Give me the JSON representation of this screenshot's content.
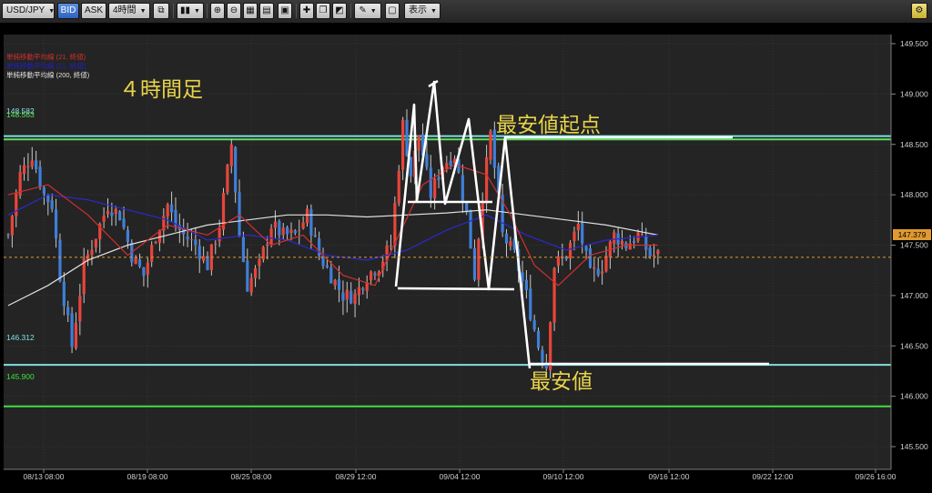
{
  "toolbar": {
    "symbol": "USD/JPY",
    "bid": "BID",
    "ask": "ASK",
    "timeframe": "4時間",
    "display": "表示",
    "icons": [
      "crosshair-icon",
      "bar-style-icon",
      "zoom-in-icon",
      "zoom-out-icon",
      "grid-icon",
      "calendar-icon",
      "add-indicator-icon",
      "copy-chart-icon",
      "drawing-tools-icon",
      "pen-icon",
      "screenshot-icon",
      "settings-icon"
    ]
  },
  "chart_data": {
    "type": "candlestick",
    "symbol": "USD/JPY",
    "timeframe": "4時間足",
    "legend": [
      {
        "label": "単純移動平均線 (21, 終値)",
        "color": "#d03030"
      },
      {
        "label": "単純移動平均線 (21, 終値)",
        "color": "#2020c0"
      },
      {
        "label": "単純移動平均線 (200, 終値)",
        "color": "#e0e0e0"
      }
    ],
    "ylim": [
      145.3,
      149.7
    ],
    "y_ticks": [
      "149.500",
      "149.000",
      "148.500",
      "148.000",
      "147.500",
      "147.000",
      "146.500",
      "146.000",
      "145.500"
    ],
    "x_ticks": [
      "08/13 08:00",
      "08/19 08:00",
      "08/25 08:00",
      "08/29 12:00",
      "09/04 12:00",
      "09/10 12:00",
      "09/16 12:00",
      "09/22 12:00",
      "09/26 16:00"
    ],
    "current_price": "147.379",
    "horizontal_lines": [
      {
        "label": "148.582",
        "value": 148.582,
        "color": "#7fe0e0"
      },
      {
        "label": "148.563",
        "value": 148.55,
        "color": "#60e060"
      },
      {
        "label": "146.312",
        "value": 146.312,
        "color": "#7fe0e0"
      },
      {
        "label": "145.900",
        "value": 145.9,
        "color": "#40e040"
      }
    ],
    "annotations": [
      {
        "text": "４時間足",
        "color": "#e8d44a"
      },
      {
        "text": "最安値起点",
        "color": "#e8d44a"
      },
      {
        "text": "最安値",
        "color": "#e8d44a"
      }
    ],
    "close_path": [
      [
        0,
        147.6
      ],
      [
        3,
        148.2
      ],
      [
        6,
        148.4
      ],
      [
        9,
        148.0
      ],
      [
        11,
        147.9
      ],
      [
        13,
        147.2
      ],
      [
        16,
        146.5
      ],
      [
        19,
        147.3
      ],
      [
        22,
        147.6
      ],
      [
        25,
        147.9
      ],
      [
        28,
        147.8
      ],
      [
        31,
        147.4
      ],
      [
        34,
        147.2
      ],
      [
        37,
        147.6
      ],
      [
        40,
        147.9
      ],
      [
        42,
        147.7
      ],
      [
        44,
        147.6
      ],
      [
        47,
        147.5
      ],
      [
        50,
        147.3
      ],
      [
        53,
        147.7
      ],
      [
        56,
        148.5
      ],
      [
        58,
        147.6
      ],
      [
        60,
        147.1
      ],
      [
        63,
        147.3
      ],
      [
        66,
        147.7
      ],
      [
        69,
        147.6
      ],
      [
        72,
        147.6
      ],
      [
        75,
        147.8
      ],
      [
        78,
        147.4
      ],
      [
        81,
        147.2
      ],
      [
        84,
        147.0
      ],
      [
        87,
        147.0
      ],
      [
        90,
        147.2
      ],
      [
        93,
        147.3
      ],
      [
        96,
        147.5
      ],
      [
        99,
        148.7
      ],
      [
        101,
        148.2
      ],
      [
        103,
        148.6
      ],
      [
        106,
        148.0
      ],
      [
        109,
        148.3
      ],
      [
        112,
        148.4
      ],
      [
        115,
        147.8
      ],
      [
        117,
        147.2
      ],
      [
        119,
        148.0
      ],
      [
        121,
        148.6
      ],
      [
        124,
        147.6
      ],
      [
        127,
        147.4
      ],
      [
        130,
        147.0
      ],
      [
        133,
        146.5
      ],
      [
        135,
        146.3
      ],
      [
        137,
        147.3
      ],
      [
        140,
        147.4
      ],
      [
        143,
        147.7
      ],
      [
        146,
        147.2
      ],
      [
        149,
        147.3
      ],
      [
        152,
        147.6
      ],
      [
        155,
        147.5
      ],
      [
        158,
        147.6
      ],
      [
        161,
        147.4
      ],
      [
        163,
        147.4
      ]
    ],
    "ma21_red": [
      [
        0,
        148.0
      ],
      [
        10,
        148.1
      ],
      [
        20,
        147.8
      ],
      [
        30,
        147.4
      ],
      [
        40,
        147.7
      ],
      [
        50,
        147.6
      ],
      [
        58,
        147.8
      ],
      [
        66,
        147.5
      ],
      [
        74,
        147.6
      ],
      [
        84,
        147.2
      ],
      [
        92,
        147.1
      ],
      [
        98,
        147.6
      ],
      [
        104,
        148.1
      ],
      [
        112,
        148.3
      ],
      [
        120,
        148.2
      ],
      [
        126,
        147.8
      ],
      [
        132,
        147.3
      ],
      [
        138,
        147.1
      ],
      [
        146,
        147.4
      ],
      [
        155,
        147.5
      ],
      [
        163,
        147.5
      ]
    ],
    "ma21_blue": [
      [
        0,
        147.8
      ],
      [
        10,
        148.0
      ],
      [
        20,
        147.95
      ],
      [
        30,
        147.85
      ],
      [
        40,
        147.75
      ],
      [
        50,
        147.55
      ],
      [
        60,
        147.6
      ],
      [
        70,
        147.55
      ],
      [
        80,
        147.4
      ],
      [
        90,
        147.35
      ],
      [
        100,
        147.45
      ],
      [
        110,
        147.65
      ],
      [
        120,
        147.8
      ],
      [
        130,
        147.6
      ],
      [
        140,
        147.45
      ],
      [
        150,
        147.55
      ],
      [
        163,
        147.6
      ]
    ],
    "ma200_white": [
      [
        0,
        146.9
      ],
      [
        10,
        147.1
      ],
      [
        20,
        147.35
      ],
      [
        30,
        147.5
      ],
      [
        40,
        147.6
      ],
      [
        50,
        147.7
      ],
      [
        60,
        147.75
      ],
      [
        70,
        147.8
      ],
      [
        80,
        147.8
      ],
      [
        90,
        147.78
      ],
      [
        100,
        147.8
      ],
      [
        110,
        147.82
      ],
      [
        120,
        147.85
      ],
      [
        130,
        147.8
      ],
      [
        140,
        147.75
      ],
      [
        150,
        147.7
      ],
      [
        163,
        147.6
      ]
    ],
    "drawn_lines": [
      [
        [
          435,
          290
        ],
        [
          455,
          90
        ],
        [
          458,
          196
        ],
        [
          477,
          65
        ],
        [
          489,
          199
        ],
        [
          515,
          106
        ],
        [
          537,
          293
        ],
        [
          555,
          126
        ],
        [
          582,
          380
        ]
      ],
      [
        [
          448,
          197
        ],
        [
          541,
          197
        ]
      ],
      [
        [
          437,
          292
        ],
        [
          565,
          293
        ]
      ],
      [
        [
          471,
          70
        ],
        [
          481,
          64
        ]
      ],
      [
        [
          555,
          126
        ],
        [
          805,
          126
        ]
      ],
      [
        [
          582,
          375
        ],
        [
          845,
          375
        ]
      ]
    ]
  }
}
